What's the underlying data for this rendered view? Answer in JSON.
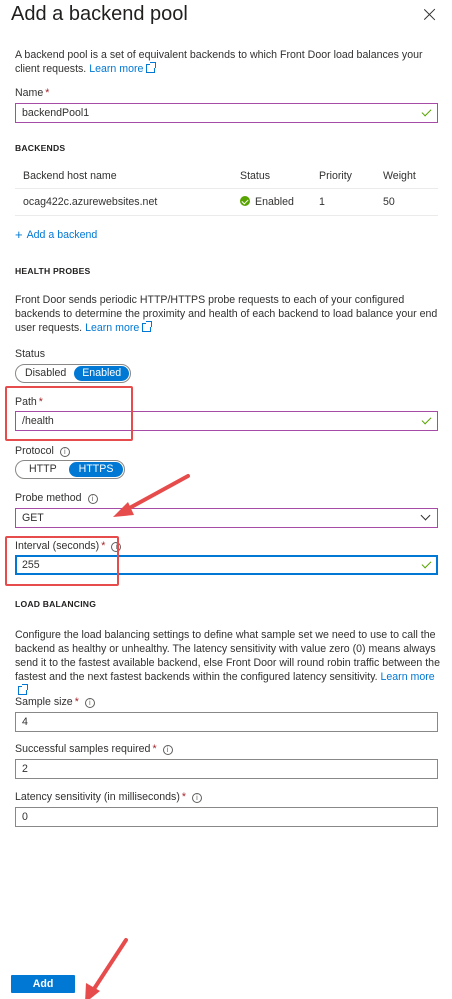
{
  "panel": {
    "title": "Add a backend pool",
    "intro": "A backend pool is a set of equivalent backends to which Front Door load balances your client requests.",
    "learn_more": "Learn more"
  },
  "name_field": {
    "label": "Name",
    "value": "backendPool1"
  },
  "backends": {
    "section_title": "BACKENDS",
    "columns": [
      "Backend host name",
      "Status",
      "Priority",
      "Weight"
    ],
    "rows": [
      {
        "host": "ocag422c.azurewebsites.net",
        "status": "Enabled",
        "priority": "1",
        "weight": "50"
      }
    ],
    "add_label": "Add a backend"
  },
  "health_probes": {
    "section_title": "HEALTH PROBES",
    "description": "Front Door sends periodic HTTP/HTTPS probe requests to each of your configured backends to determine the proximity and health of each backend to load balance your end user requests.",
    "learn_more": "Learn more",
    "status": {
      "label": "Status",
      "options": [
        "Disabled",
        "Enabled"
      ],
      "selected": "Enabled"
    },
    "path": {
      "label": "Path",
      "value": "/health"
    },
    "protocol": {
      "label": "Protocol",
      "options": [
        "HTTP",
        "HTTPS"
      ],
      "selected": "HTTPS"
    },
    "probe_method": {
      "label": "Probe method",
      "value": "GET"
    },
    "interval": {
      "label": "Interval (seconds)",
      "value": "255"
    }
  },
  "load_balancing": {
    "section_title": "LOAD BALANCING",
    "description": "Configure the load balancing settings to define what sample set we need to use to call the backend as healthy or unhealthy. The latency sensitivity with value zero (0) means always send it to the fastest available backend, else Front Door will round robin traffic between the fastest and the next fastest backends within the configured latency sensitivity.",
    "learn_more": "Learn more",
    "sample_size": {
      "label": "Sample size",
      "value": "4"
    },
    "successful_samples": {
      "label": "Successful samples required",
      "value": "2"
    },
    "latency": {
      "label": "Latency sensitivity (in milliseconds)",
      "value": "0"
    }
  },
  "footer": {
    "add_button": "Add"
  },
  "icons": {
    "close": "close-icon",
    "external": "external-link-icon",
    "info": "info-icon",
    "check": "check-icon",
    "status": "status-enabled-icon",
    "plus": "plus-icon",
    "chevron": "chevron-down-icon"
  },
  "colors": {
    "accent": "#0078d4",
    "success": "#57a300",
    "required": "#a4262c",
    "annotation": "#e74c4c"
  }
}
